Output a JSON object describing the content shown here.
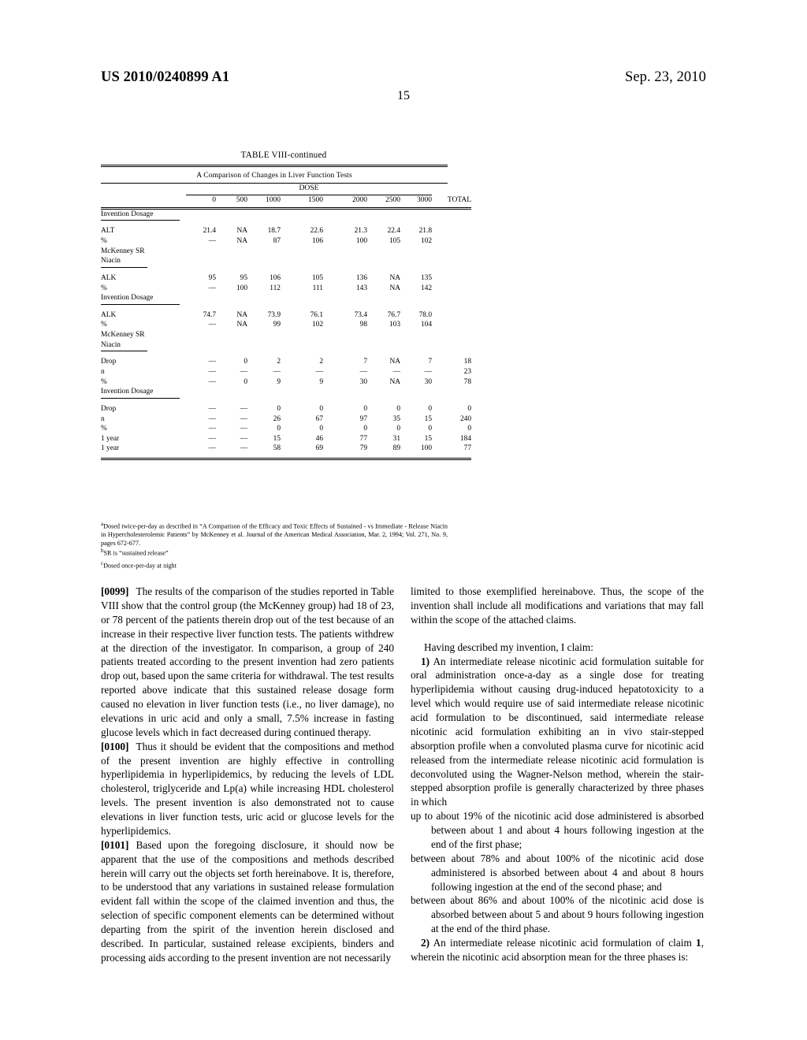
{
  "header": {
    "publication_number": "US 2010/0240899 A1",
    "publication_date": "Sep. 23, 2010",
    "page_number": "15"
  },
  "table": {
    "title": "TABLE VIII-continued",
    "subtitle": "A Comparison of Changes in Liver Function Tests",
    "group_header": "DOSE",
    "columns": [
      "0",
      "500",
      "1000",
      "1500",
      "2000",
      "2500",
      "3000",
      "TOTAL"
    ],
    "blocks": [
      {
        "group_label": "Invention Dosage",
        "rows": [
          {
            "label": "ALT",
            "values": [
              "21.4",
              "NA",
              "18.7",
              "22.6",
              "21.3",
              "22.4",
              "21.8",
              ""
            ]
          },
          {
            "label": "%",
            "values": [
              "—",
              "NA",
              "87",
              "106",
              "100",
              "105",
              "102",
              ""
            ]
          },
          {
            "label": "McKenney SR",
            "values": [
              "",
              "",
              "",
              "",
              "",
              "",
              "",
              ""
            ]
          },
          {
            "label": "Niacin",
            "values": [
              "",
              "",
              "",
              "",
              "",
              "",
              "",
              ""
            ],
            "underline": true
          }
        ]
      },
      {
        "group_label": "Invention Dosage",
        "rows": [
          {
            "label": "ALK",
            "values": [
              "95",
              "95",
              "106",
              "105",
              "136",
              "NA",
              "135",
              ""
            ]
          },
          {
            "label": "%",
            "values": [
              "—",
              "100",
              "112",
              "111",
              "143",
              "NA",
              "142",
              ""
            ]
          }
        ]
      },
      {
        "group_label": "McKenney SR Niacin",
        "rows": [
          {
            "label": "ALK",
            "values": [
              "74.7",
              "NA",
              "73.9",
              "76.1",
              "73.4",
              "76.7",
              "78.0",
              ""
            ]
          },
          {
            "label": "%",
            "values": [
              "—",
              "NA",
              "99",
              "102",
              "98",
              "103",
              "104",
              ""
            ]
          },
          {
            "label": "McKenney SR",
            "values": [
              "",
              "",
              "",
              "",
              "",
              "",
              "",
              ""
            ]
          },
          {
            "label": "Niacin",
            "values": [
              "",
              "",
              "",
              "",
              "",
              "",
              "",
              ""
            ],
            "underline": true
          }
        ]
      },
      {
        "group_label": "Invention Dosage",
        "rows": [
          {
            "label": "Drop",
            "values": [
              "—",
              "0",
              "2",
              "2",
              "7",
              "NA",
              "7",
              "18"
            ]
          },
          {
            "label": "n",
            "values": [
              "—",
              "—",
              "—",
              "—",
              "—",
              "—",
              "—",
              "23"
            ]
          },
          {
            "label": "%",
            "values": [
              "—",
              "0",
              "9",
              "9",
              "30",
              "NA",
              "30",
              "78"
            ]
          }
        ]
      },
      {
        "group_label": "",
        "rows": [
          {
            "label": "Drop",
            "values": [
              "—",
              "—",
              "0",
              "0",
              "0",
              "0",
              "0",
              "0"
            ]
          },
          {
            "label": "n",
            "values": [
              "—",
              "—",
              "26",
              "67",
              "97",
              "35",
              "15",
              "240"
            ]
          },
          {
            "label": "%",
            "values": [
              "—",
              "—",
              "0",
              "0",
              "0",
              "0",
              "0",
              "0"
            ]
          },
          {
            "label": "1 year",
            "values": [
              "—",
              "—",
              "15",
              "46",
              "77",
              "31",
              "15",
              "184"
            ]
          },
          {
            "label": "1 year",
            "values": [
              "—",
              "—",
              "58",
              "69",
              "79",
              "89",
              "100",
              "77"
            ]
          }
        ]
      }
    ],
    "footnotes": {
      "a_marker": "a",
      "a_text": "Dosed twice-per-day as described in “A Comparison of the Efficacy and Toxic Effects of Sustained - vs Immediate - Release Niacin in Hypercholesterolemic Patients” by McKenney et al. Journal of the American Medical Association, Mar. 2, 1994; Vol. 271, No. 9, pages 672-677.",
      "b_marker": "b",
      "b_text": "SR is “sustained release”",
      "c_marker": "c",
      "c_text": "Dosed once-per-day at night"
    }
  },
  "body": {
    "left_column": [
      {
        "number": "[0099]",
        "text": "The results of the comparison of the studies reported in Table VIII show that the control group (the McKenney group) had 18 of 23, or 78 percent of the patients therein drop out of the test because of an increase in their respective liver function tests. The patients withdrew at the direction of the investigator. In comparison, a group of 240 patients treated according to the present invention had zero patients drop out, based upon the same criteria for withdrawal. The test results reported above indicate that this sustained release dosage form caused no elevation in liver function tests (i.e., no liver damage), no elevations in uric acid and only a small, 7.5% increase in fasting glucose levels which in fact decreased during continued therapy."
      },
      {
        "number": "[0100]",
        "text": "Thus it should be evident that the compositions and method of the present invention are highly effective in controlling hyperlipidemia in hyperlipidemics, by reducing the levels of LDL cholesterol, triglyceride and Lp(a) while increasing HDL cholesterol levels. The present invention is also demonstrated not to cause elevations in liver function tests, uric acid or glucose levels for the hyperlipidemics."
      },
      {
        "number": "[0101]",
        "text": "Based upon the foregoing disclosure, it should now be apparent that the use of the compositions and methods described herein will carry out the objects set forth hereinabove. It is, therefore, to be understood that any variations in sustained release formulation evident fall within the scope of the claimed invention and thus, the selection of specific component elements can be determined without departing from the spirit of the invention herein disclosed and described. In particular, sustained release excipients, binders and processing aids according to the present invention are not necessarily"
      }
    ],
    "right_column": {
      "continuation": "limited to those exemplified hereinabove. Thus, the scope of the invention shall include all modifications and variations that may fall within the scope of the attached claims.",
      "claims_intro": "Having described my invention, I claim:",
      "claim1_number": "1)",
      "claim1_text": "An intermediate release nicotinic acid formulation suitable for oral administration once-a-day as a single dose for treating hyperlipidemia without causing drug-induced hepatotoxicity to a level which would require use of said intermediate release nicotinic acid formulation to be discontinued, said intermediate release nicotinic acid formulation exhibiting an in vivo stair-stepped absorption profile when a convoluted plasma curve for nicotinic acid released from the intermediate release nicotinic acid formulation is deconvoluted using the Wagner-Nelson method, wherein the stair-stepped absorption profile is generally characterized by three phases in which",
      "phases": [
        "up to about 19% of the nicotinic acid dose administered is absorbed between about 1 and about 4 hours following ingestion at the end of the first phase;",
        "between about 78% and about 100% of the nicotinic acid dose administered is absorbed between about 4 and about 8 hours following ingestion at the end of the second phase; and",
        "between about 86% and about 100% of the nicotinic acid dose is absorbed between about 5 and about 9 hours following ingestion at the end of the third phase."
      ],
      "claim2_number": "2)",
      "claim2_text_a": "An intermediate release nicotinic acid formulation of claim ",
      "claim2_ref": "1",
      "claim2_text_b": ", wherein the nicotinic acid absorption mean for the three phases is:"
    }
  }
}
